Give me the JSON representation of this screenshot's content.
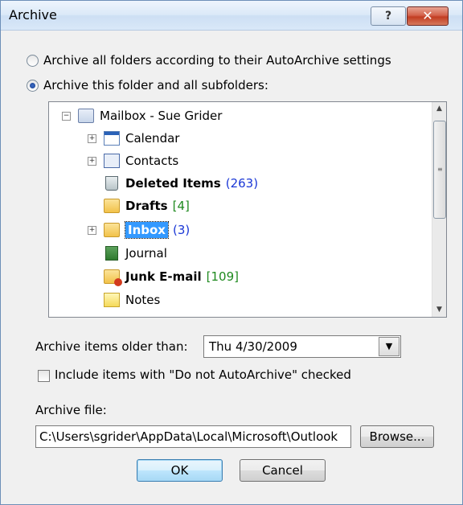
{
  "window": {
    "title": "Archive",
    "help_label": "?",
    "close_label": "✕"
  },
  "options": {
    "archive_all_label": "Archive all folders according to their AutoArchive settings",
    "archive_this_label": "Archive this folder and all subfolders:"
  },
  "tree": {
    "items": [
      {
        "label": "Mailbox - Sue Grider",
        "icon": "mailbox-icon",
        "expander": "−",
        "count": "",
        "bold": false
      },
      {
        "label": "Calendar",
        "icon": "calendar-icon",
        "expander": "+",
        "count": "",
        "bold": false
      },
      {
        "label": "Contacts",
        "icon": "contacts-icon",
        "expander": "+",
        "count": "",
        "bold": false
      },
      {
        "label": "Deleted Items",
        "icon": "trash-icon",
        "expander": "",
        "count": "(263)",
        "bold": true
      },
      {
        "label": "Drafts",
        "icon": "drafts-icon",
        "expander": "",
        "count": "[4]",
        "bold": true
      },
      {
        "label": "Inbox",
        "icon": "inbox-icon",
        "expander": "+",
        "count": "(3)",
        "bold": true,
        "selected": true
      },
      {
        "label": "Journal",
        "icon": "journal-icon",
        "expander": "",
        "count": "",
        "bold": false
      },
      {
        "label": "Junk E-mail",
        "icon": "junk-icon",
        "expander": "",
        "count": "[109]",
        "bold": true
      },
      {
        "label": "Notes",
        "icon": "notes-icon",
        "expander": "",
        "count": "",
        "bold": false
      }
    ],
    "scroll_up": "▲",
    "scroll_down": "▼"
  },
  "older_than": {
    "label": "Archive items older than:",
    "value": "Thu 4/30/2009",
    "dropdown_glyph": "▼"
  },
  "include_checkbox": {
    "label": "Include items with \"Do not AutoArchive\" checked",
    "checked": false
  },
  "archive_file": {
    "label": "Archive file:",
    "value": "C:\\Users\\sgrider\\AppData\\Local\\Microsoft\\Outlook",
    "browse_label": "Browse..."
  },
  "buttons": {
    "ok": "OK",
    "cancel": "Cancel"
  }
}
